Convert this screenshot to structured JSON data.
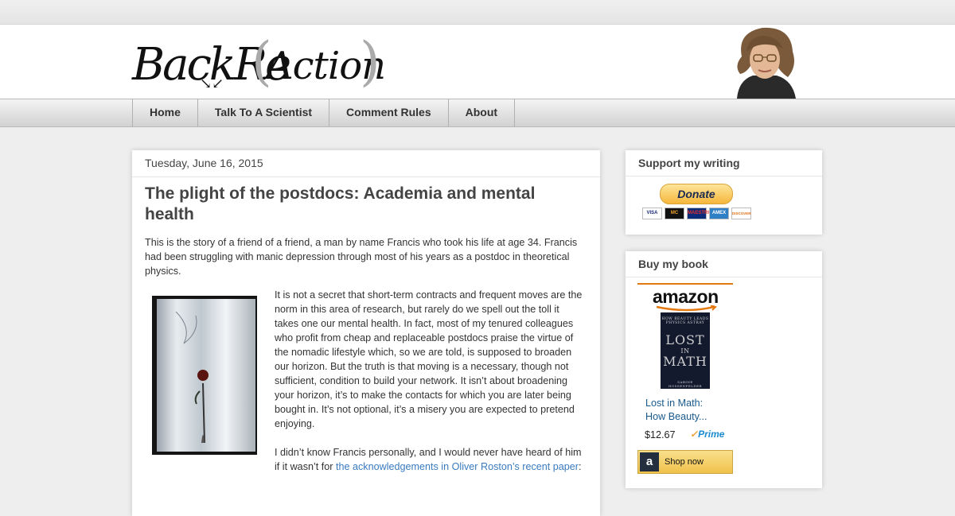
{
  "header": {
    "logo": {
      "back": "BackRe",
      "paren_open": "(",
      "action": "Action",
      "paren_close": ")"
    }
  },
  "nav": {
    "tabs": [
      "Home",
      "Talk To A Scientist",
      "Comment Rules",
      "About"
    ]
  },
  "post": {
    "date": "Tuesday, June 16, 2015",
    "title": "The plight of the postdocs: Academia and mental health",
    "intro": "This is the story of a friend of a friend, a man by name Francis who took his life at age 34. Francis had been struggling with manic depression through most of his years as a postdoc in theoretical physics.",
    "para1": "It is not a secret that short-term contracts and frequent moves are the norm in this area of research, but rarely do we spell out the toll it takes one our mental health. In fact, most of my tenured colleagues who profit from cheap and replaceable postdocs praise the virtue of the nomadic lifestyle which, so we are told, is supposed to broaden our horizon. But the truth is that moving is a necessary, though not sufficient, condition to build your network. It isn’t about broadening your horizon, it’s to make the contacts for which you are later being bought in. It’s not optional, it’s a misery you are expected to pretend enjoying.",
    "para2_text": "I didn’t know Francis personally, and I would never have heard of him if it wasn’t for ",
    "para2_link": "the acknowledgements in Oliver Roston’s recent paper",
    "para2_end": ":"
  },
  "sidebar": {
    "support": {
      "title": "Support my writing",
      "donate_label": "Donate",
      "cards": [
        "VISA",
        "MC",
        "MAESTRO",
        "AMEX",
        "DISCOVER"
      ]
    },
    "book": {
      "title": "Buy my book",
      "amazon_word": "amazon",
      "cover_top": "HOW BEAUTY LEADS PHYSICS ASTRAY",
      "cover_title_1": "LOST",
      "cover_title_2": "IN",
      "cover_title_3": "MATH",
      "cover_author": "SABINE HOSSENFELDER",
      "link_line1": "Lost in Math:",
      "link_line2": "How Beauty...",
      "price": "$12.67",
      "prime": "Prime",
      "shop_label": "Shop now",
      "shop_icon": "a"
    }
  },
  "colors": {
    "accent_link": "#3a7bbf",
    "amazon_orange": "#e47911",
    "background": "#eeeeee"
  },
  "icons": {
    "portrait": "author-portrait",
    "logo_arrows": "arrow-down-icon"
  }
}
